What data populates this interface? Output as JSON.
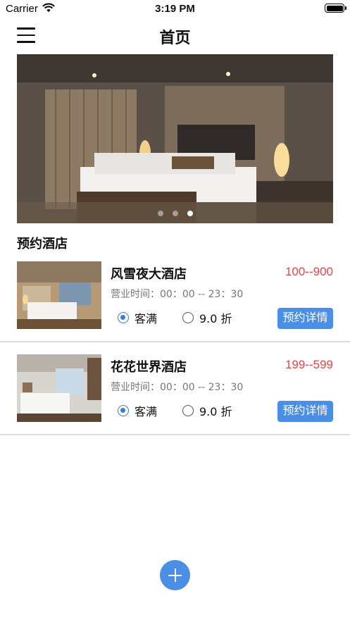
{
  "status_bar": {
    "carrier": "Carrier",
    "time": "3:19 PM"
  },
  "nav": {
    "title": "首页"
  },
  "banner": {
    "active_slide_index": 2
  },
  "section": {
    "title": "预约酒店"
  },
  "hotels": [
    {
      "name": "风雪夜大酒店",
      "price": "100--900",
      "hours": "营业时间：00：00 -- 23：30",
      "options": [
        {
          "label": "客满",
          "checked": true
        },
        {
          "label": "9.0 折",
          "checked": false
        }
      ],
      "button_label": "预约详情"
    },
    {
      "name": "花花世界酒店",
      "price": "199--599",
      "hours": "营业时间：00：00 -- 23：30",
      "options": [
        {
          "label": "客满",
          "checked": true
        },
        {
          "label": "9.0 折",
          "checked": false
        }
      ],
      "button_label": "预约详情"
    }
  ],
  "colors": {
    "accent": "#4a8ee6",
    "price": "#e8454a",
    "divider": "#dcdcdc"
  },
  "icons": {
    "menu": "hamburger-menu-icon",
    "add": "plus-icon",
    "wifi": "wifi-icon",
    "battery": "battery-icon"
  }
}
